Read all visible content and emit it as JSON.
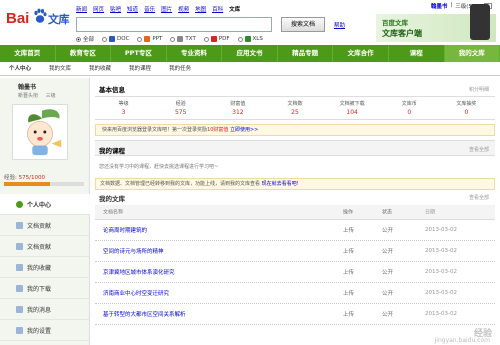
{
  "brand": {
    "logo_bai": "Bai",
    "logo_du": "文库"
  },
  "top_nav": [
    "新闻",
    "网页",
    "贴吧",
    "知道",
    "音乐",
    "图片",
    "视频",
    "地图",
    "百科",
    "文库"
  ],
  "top_nav_current": "文库",
  "search": {
    "value": "",
    "button": "搜索文档",
    "help": "帮助"
  },
  "filters": [
    {
      "label": "全部",
      "type": "radio",
      "checked": true
    },
    {
      "label": "DOC",
      "type": "radio",
      "color": "#2b59c3"
    },
    {
      "label": "PPT",
      "type": "radio",
      "color": "#e3641c"
    },
    {
      "label": "TXT",
      "type": "radio",
      "color": "#888888"
    },
    {
      "label": "PDF",
      "type": "radio",
      "color": "#d8251d"
    },
    {
      "label": "XLS",
      "type": "radio",
      "color": "#2e8b2e"
    }
  ],
  "user": {
    "name": "翰墨书",
    "messages": "三级(575)",
    "sep": "|"
  },
  "app_banner": {
    "line1": "百度文库",
    "line2": "文库客户端"
  },
  "main_nav": [
    "文库首页",
    "教育专区",
    "PPT专区",
    "专业资料",
    "应用文书",
    "精品专题",
    "文库合作",
    "课程",
    "我的文库"
  ],
  "main_nav_active": "我的文库",
  "sub_nav": [
    "个人中心",
    "我的文库",
    "我的收藏",
    "我的课程",
    "我的任务"
  ],
  "sub_nav_active": "个人中心",
  "profile": {
    "name": "翰墨书",
    "sub": "新晋头衔",
    "level": "三级",
    "exp_label": "经验:",
    "exp_value": "575/1000",
    "exp_progress": 0.575
  },
  "side_menu": [
    "个人中心",
    "文档贡献",
    "文档贡献",
    "我的收藏",
    "我的下载",
    "我的消息",
    "我的设置"
  ],
  "side_menu_active": "个人中心",
  "basic_info": {
    "title": "基本信息",
    "right_link": "积分明细",
    "stats": [
      {
        "label": "等级",
        "value": "3"
      },
      {
        "label": "经验",
        "value": "575"
      },
      {
        "label": "财富值",
        "value": "312"
      },
      {
        "label": "文档数",
        "value": "25"
      },
      {
        "label": "文档被下载",
        "value": "104"
      },
      {
        "label": "文库币",
        "value": "0"
      },
      {
        "label": "文库抽奖",
        "value": "0"
      }
    ]
  },
  "tip": {
    "text": "快来用百度浏览器登录文库吧！第一次登录奖励",
    "highlight": "10财富值",
    "link": "立即使用>>"
  },
  "courses": {
    "title": "我的课程",
    "more": "查看全部",
    "empty": "您还没有学习中的课程，赶快去挑选课程进行学习吧~"
  },
  "notice": {
    "text": "文档数据、文档管理已经转移到我的文库，功能上线，请到我的文库查看",
    "link": "现在就去看看吧!"
  },
  "library": {
    "title": "我的文库",
    "more": "查看全部",
    "headers": {
      "name": "文档名称",
      "action": "操作",
      "status": "状态",
      "date": "日期"
    },
    "rows": [
      {
        "name": "论商周时期建筑的",
        "action": "上传",
        "status": "公开",
        "date": "2013-03-02"
      },
      {
        "name": "空间的诗元与场所的精神",
        "action": "上传",
        "status": "公开",
        "date": "2013-03-02"
      },
      {
        "name": "京津冀地区城市体系演化研究",
        "action": "上传",
        "status": "公开",
        "date": "2013-03-02"
      },
      {
        "name": "济南商业中心时空变迁研究",
        "action": "上传",
        "status": "公开",
        "date": "2013-03-02"
      },
      {
        "name": "基于转型的大都市区空间关系解析",
        "action": "上传",
        "status": "公开",
        "date": "2013-03-02"
      }
    ]
  },
  "watermark": {
    "main": "经验",
    "sub": "jingyan.baidu.com"
  }
}
